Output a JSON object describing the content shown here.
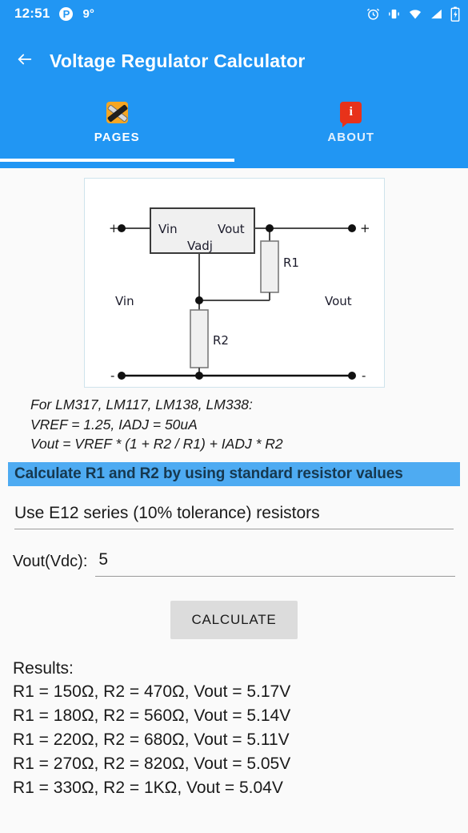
{
  "status_bar": {
    "time": "12:51",
    "p_badge": "P",
    "temperature": "9°",
    "icons": [
      "alarm-icon",
      "vibrate-icon",
      "wifi-icon",
      "signal-icon",
      "battery-charging-icon"
    ]
  },
  "app_bar": {
    "back_icon": "back-arrow-icon",
    "title": "Voltage Regulator Calculator",
    "accent_color": "#2196f3"
  },
  "tabs": [
    {
      "label": "PAGES",
      "icon": "tools-icon",
      "active": true
    },
    {
      "label": "ABOUT",
      "icon": "info-bubble-icon",
      "active": false
    }
  ],
  "diagram": {
    "block_labels": {
      "vin": "Vin",
      "vout": "Vout",
      "vadj": "Vadj"
    },
    "resistor_r1": "R1",
    "resistor_r2": "R2",
    "left_label": "Vin",
    "right_label": "Vout",
    "terminal_plus_left": "+",
    "terminal_plus_right": "+",
    "terminal_minus_left": "-",
    "terminal_minus_right": "-"
  },
  "formula": {
    "line1": "For LM317, LM117, LM138, LM338:",
    "line2": "VREF = 1.25, IADJ = 50uA",
    "line3": "Vout = VREF * (1 + R2 / R1) + IADJ * R2"
  },
  "section": {
    "banner": "Calculate R1 and R2 by using standard resistor values",
    "banner_bg": "#4eabf2"
  },
  "series_select": {
    "value": "Use E12 series (10% tolerance) resistors"
  },
  "vout_input": {
    "label": "Vout(Vdc):",
    "value": "5",
    "placeholder": ""
  },
  "calculate_button": {
    "label": "CALCULATE"
  },
  "results": {
    "heading": "Results:",
    "lines": [
      "R1 = 150Ω,  R2 = 470Ω,  Vout = 5.17V",
      "R1 = 180Ω,  R2 = 560Ω,  Vout = 5.14V",
      "R1 = 220Ω,  R2 = 680Ω,  Vout = 5.11V",
      "R1 = 270Ω,  R2 = 820Ω,  Vout = 5.05V",
      "R1 = 330Ω,  R2 = 1KΩ,  Vout = 5.04V"
    ]
  }
}
